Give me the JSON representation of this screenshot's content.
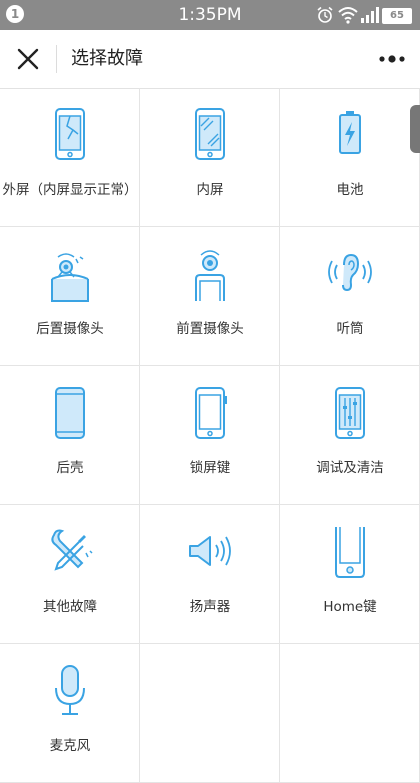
{
  "status_bar": {
    "notification_count": "1",
    "time": "1:35PM",
    "battery": "65"
  },
  "nav": {
    "title": "选择故障"
  },
  "faults": [
    {
      "label": "外屏（内屏显示正常）",
      "icon": "cracked-phone-icon"
    },
    {
      "label": "内屏",
      "icon": "inner-screen-icon"
    },
    {
      "label": "电池",
      "icon": "battery-icon"
    },
    {
      "label": "后置摄像头",
      "icon": "rear-camera-icon"
    },
    {
      "label": "前置摄像头",
      "icon": "front-camera-icon"
    },
    {
      "label": "听筒",
      "icon": "earpiece-icon"
    },
    {
      "label": "后壳",
      "icon": "back-shell-icon"
    },
    {
      "label": "锁屏键",
      "icon": "lock-button-icon"
    },
    {
      "label": "调试及清洁",
      "icon": "adjust-clean-icon"
    },
    {
      "label": "其他故障",
      "icon": "tools-icon"
    },
    {
      "label": "扬声器",
      "icon": "speaker-icon"
    },
    {
      "label": "Home键",
      "icon": "home-button-icon"
    },
    {
      "label": "麦克风",
      "icon": "microphone-icon"
    }
  ],
  "colors": {
    "accent": "#3aa3e3",
    "accent_light": "#cfe9fa",
    "status_bar": "#8a8a8a"
  }
}
